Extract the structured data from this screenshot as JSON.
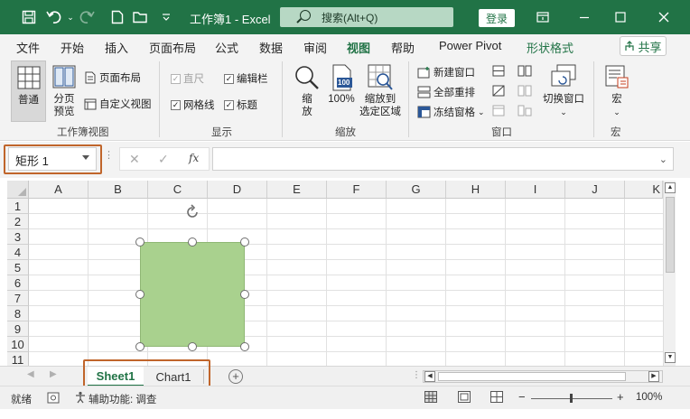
{
  "titlebar": {
    "title": "工作簿1  -  Excel",
    "search_placeholder": "搜索(Alt+Q)",
    "login_label": "登录",
    "quick_access": [
      "save-icon",
      "undo-icon",
      "redo-icon",
      "new-file-icon",
      "open-folder-icon",
      "customize-icon"
    ],
    "window_controls": [
      "ribbon-display-icon",
      "minimize-icon",
      "maximize-icon",
      "close-icon"
    ],
    "accent_color": "#217346"
  },
  "menu": {
    "tabs": [
      "文件",
      "开始",
      "插入",
      "页面布局",
      "公式",
      "数据",
      "审阅",
      "视图",
      "帮助",
      "Power Pivot",
      "形状格式"
    ],
    "active_tab": "视图",
    "contextual_tab": "形状格式",
    "share_label": "共享"
  },
  "ribbon": {
    "workbook_views": {
      "label": "工作簿视图",
      "normal": "普通",
      "page_break_line1": "分页",
      "page_break_line2": "预览",
      "page_layout": "页面布局",
      "custom_views": "自定义视图"
    },
    "show": {
      "label": "显示",
      "ruler": "直尺",
      "formula_bar": "编辑栏",
      "gridlines": "网格线",
      "headings": "标题",
      "ruler_checked": true,
      "formula_bar_checked": true,
      "gridlines_checked": true,
      "headings_checked": true
    },
    "zoom": {
      "label": "缩放",
      "zoom_line1": "缩",
      "zoom_line2": "放",
      "hundred": "100%",
      "hundred_icon_text": "100",
      "zoom_selection_line1": "缩放到",
      "zoom_selection_line2": "选定区域"
    },
    "window": {
      "label": "窗口",
      "new_window": "新建窗口",
      "arrange_all": "全部重排",
      "freeze_panes": "冻结窗格",
      "switch_windows": "切换窗口"
    },
    "macros": {
      "label": "宏",
      "macros": "宏"
    }
  },
  "formula_bar": {
    "name_box": "矩形 1",
    "formula": "",
    "fx": "fx"
  },
  "grid": {
    "columns": [
      "A",
      "B",
      "C",
      "D",
      "E",
      "F",
      "G",
      "H",
      "I",
      "J",
      "K"
    ],
    "rows": [
      "1",
      "2",
      "3",
      "4",
      "5",
      "6",
      "7",
      "8",
      "9",
      "10",
      "11"
    ]
  },
  "shape": {
    "name": "矩形 1",
    "fill_color": "#a9d18e"
  },
  "sheets": {
    "tabs": [
      "Sheet1",
      "Chart1"
    ],
    "active": "Sheet1"
  },
  "statusbar": {
    "ready": "就绪",
    "accessibility": "辅助功能: 调查",
    "zoom_level": "100%",
    "zoom_minus": "−",
    "zoom_plus": "+"
  },
  "highlight_color": "#c0652b"
}
